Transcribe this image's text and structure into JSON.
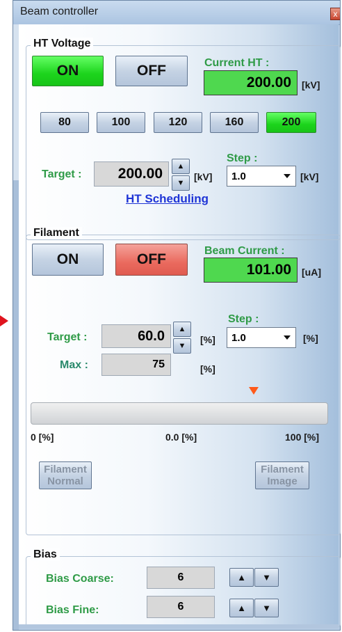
{
  "window": {
    "title": "Beam controller",
    "close_label": "x"
  },
  "ht": {
    "title": "HT Voltage",
    "on_label": "ON",
    "off_label": "OFF",
    "current_label": "Current HT :",
    "current_value": "200.00",
    "current_unit": "[kV]",
    "presets": [
      "80",
      "100",
      "120",
      "160",
      "200"
    ],
    "target_label": "Target  :",
    "target_value": "200.00",
    "target_unit": "[kV]",
    "step_label": "Step :",
    "step_value": "1.0",
    "step_unit": "[kV]",
    "scheduling_link": "HT Scheduling",
    "up_arrow": "▲",
    "down_arrow": "▼"
  },
  "filament": {
    "title": "Filament",
    "on_label": "ON",
    "off_label": "OFF",
    "current_label": "Beam Current :",
    "current_value": "101.00",
    "current_unit": "[uA]",
    "target_label": "Target :",
    "target_value": "60.0",
    "target_unit": "[%]",
    "step_label": "Step :",
    "step_value": "1.0",
    "step_unit": "[%]",
    "max_label": "Max :",
    "max_value": "75",
    "max_unit": "[%]",
    "progress_min": "0 [%]",
    "progress_mid": "0.0 [%]",
    "progress_max": "100 [%]",
    "progress_value": 0.0,
    "marker_value": 75,
    "normal_button": "Filament Normal",
    "image_button": "Filament Image",
    "up_arrow": "▲",
    "down_arrow": "▼"
  },
  "bias": {
    "title": "Bias",
    "coarse_label": "Bias Coarse:",
    "coarse_value": "6",
    "fine_label": "Bias Fine:",
    "fine_value": "6",
    "up_arrow": "▲",
    "down_arrow": "▼"
  },
  "colors": {
    "on_green": "#1cd41c",
    "readout_green": "#4fd84f",
    "off_red": "#ea6a5e",
    "label_green": "#2f9b47",
    "link_blue": "#1f35d6",
    "marker_orange": "#ff5a1a",
    "indicator_arrow": "#e0141e"
  }
}
